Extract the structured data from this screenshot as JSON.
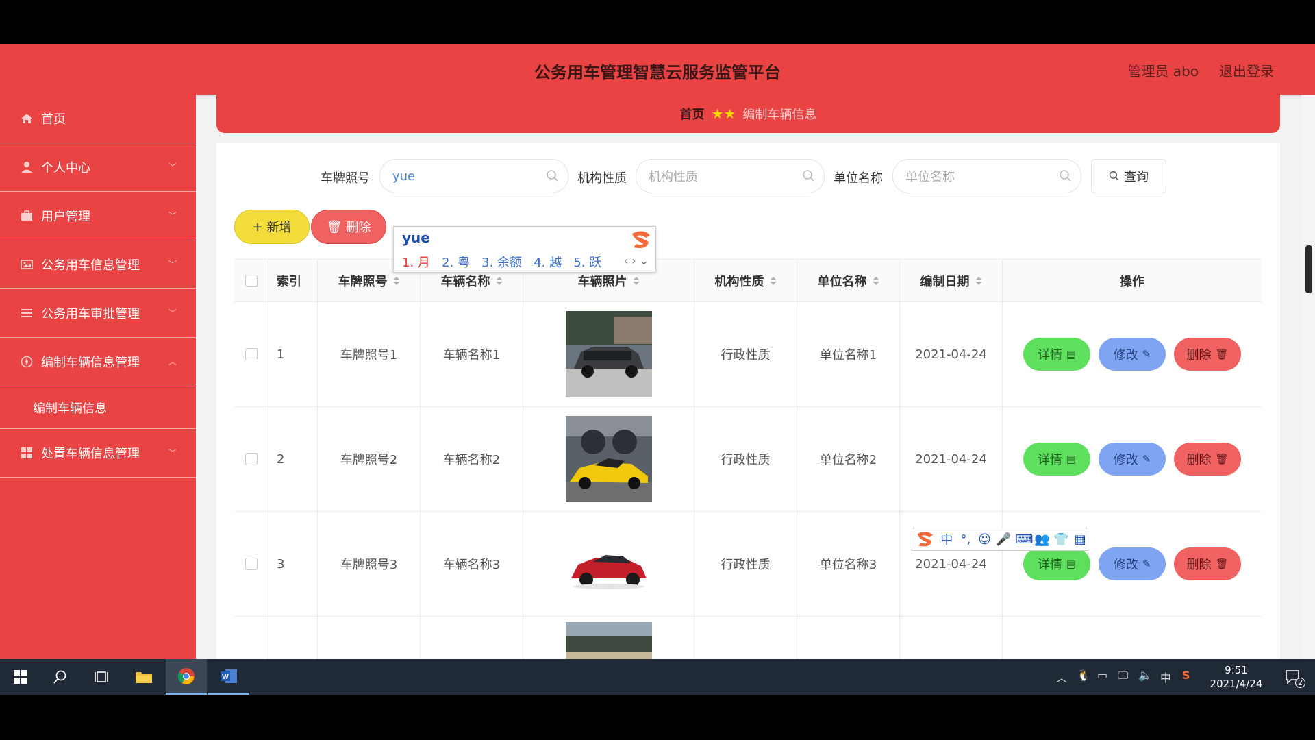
{
  "header": {
    "title": "公务用车管理智慧云服务监管平台",
    "user": "管理员 abo",
    "logout": "退出登录"
  },
  "sidebar": {
    "items": [
      {
        "label": "首页"
      },
      {
        "label": "个人中心"
      },
      {
        "label": "用户管理"
      },
      {
        "label": "公务用车信息管理"
      },
      {
        "label": "公务用车审批管理"
      },
      {
        "label": "编制车辆信息管理"
      },
      {
        "label": "处置车辆信息管理"
      }
    ],
    "submenu": {
      "label": "编制车辆信息"
    }
  },
  "breadcrumb": {
    "home": "首页",
    "current": "编制车辆信息"
  },
  "search": {
    "plate_label": "车牌照号",
    "plate_value": "yue",
    "org_label": "机构性质",
    "org_placeholder": "机构性质",
    "unit_label": "单位名称",
    "unit_placeholder": "单位名称",
    "query_button": "查询"
  },
  "actions": {
    "add": "新增",
    "delete": "删除"
  },
  "ime": {
    "composition": "yue",
    "candidates": [
      "1. 月",
      "2. 粤",
      "3. 余额",
      "4. 越",
      "5. 跃"
    ],
    "toolbar": [
      "中",
      "°,",
      "☺",
      "🎤",
      "⌨",
      "👥",
      "👕",
      "▦"
    ]
  },
  "table": {
    "headers": {
      "index": "索引",
      "plate": "车牌照号",
      "name": "车辆名称",
      "photo": "车辆照片",
      "org": "机构性质",
      "unit": "单位名称",
      "date": "编制日期",
      "ops": "操作"
    },
    "rows": [
      {
        "index": "1",
        "plate": "车牌照号1",
        "name": "车辆名称1",
        "org": "行政性质",
        "unit": "单位名称1",
        "date": "2021-04-24"
      },
      {
        "index": "2",
        "plate": "车牌照号2",
        "name": "车辆名称2",
        "org": "行政性质",
        "unit": "单位名称2",
        "date": "2021-04-24"
      },
      {
        "index": "3",
        "plate": "车牌照号3",
        "name": "车辆名称3",
        "org": "行政性质",
        "unit": "单位名称3",
        "date": "2021-04-24"
      }
    ],
    "op_labels": {
      "detail": "详情",
      "edit": "修改",
      "delete": "删除"
    }
  },
  "taskbar": {
    "time": "9:51",
    "date": "2021/4/24",
    "ime": "中",
    "notifications": "2"
  }
}
